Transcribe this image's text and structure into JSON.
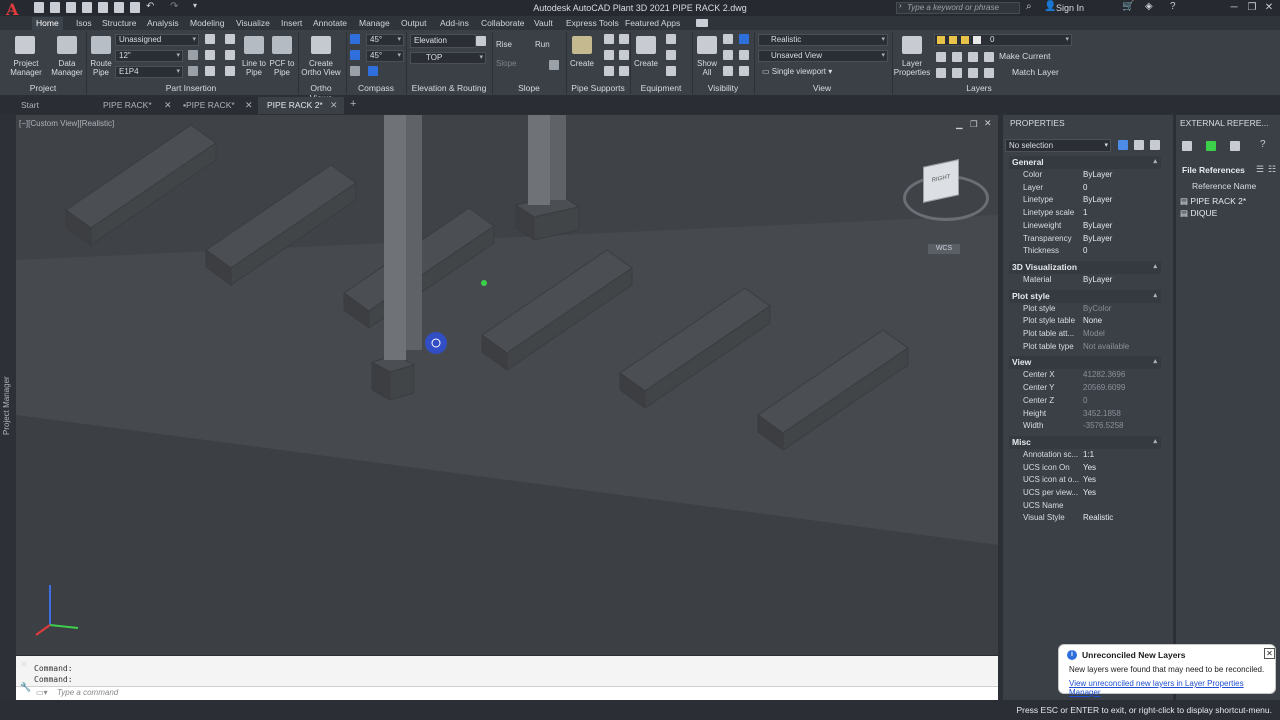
{
  "app": {
    "title": "Autodesk AutoCAD Plant 3D 2021    PIPE RACK 2.dwg",
    "search_placeholder": "Type a keyword or phrase",
    "sign_in": "Sign In"
  },
  "ribbon_tabs": [
    "Home",
    "Isos",
    "Structure",
    "Analysis",
    "Modeling",
    "Visualize",
    "Insert",
    "Annotate",
    "Manage",
    "Output",
    "Add-ins",
    "Collaborate",
    "Vault",
    "Express Tools",
    "Featured Apps"
  ],
  "ribbon": {
    "project": {
      "title": "Project",
      "project_manager": "Project\nManager",
      "data_manager": "Data\nManager"
    },
    "part_insertion": {
      "title": "Part Insertion",
      "route_pipe": "Route\nPipe",
      "line_to_pipe": "Line to\nPipe",
      "pcf_to_pipe": "PCF to\nPipe",
      "spec": "Unassigned",
      "size": "12\"",
      "line_number": "E1P4"
    },
    "ortho_views": {
      "title": "Ortho Views",
      "create": "Create\nOrtho View"
    },
    "compass": {
      "title": "Compass",
      "angle1": "45°",
      "angle2": "45°"
    },
    "elevation": {
      "title": "Elevation & Routing",
      "elevation_label": "Elevation",
      "plane": "TOP"
    },
    "slope": {
      "title": "Slope",
      "rise": "Rise",
      "run": "Run",
      "slope": "Slope"
    },
    "pipe_supports": {
      "title": "Pipe Supports",
      "create": "Create"
    },
    "equipment": {
      "title": "Equipment",
      "create": "Create"
    },
    "visibility": {
      "title": "Visibility",
      "show_all": "Show\nAll"
    },
    "view": {
      "title": "View",
      "visual_style": "Realistic",
      "named_view": "Unsaved View",
      "viewport": "Single viewport"
    },
    "layers": {
      "title": "Layers",
      "layer_properties": "Layer\nProperties",
      "current_layer": "0",
      "make_current": "Make Current",
      "match_layer": "Match Layer"
    }
  },
  "doc_tabs": {
    "start": "Start",
    "tabs": [
      "PIPE RACK*",
      "PIPE RACK*",
      "PIPE RACK 2*"
    ]
  },
  "viewport": {
    "label": "[−][Custom View][Realistic]",
    "viewcube_face": "RIGHT",
    "wcs": "WCS"
  },
  "sidebar": {
    "project_manager": "Project Manager"
  },
  "command": {
    "history": [
      "Command:",
      "Command:"
    ],
    "placeholder": "Type a command"
  },
  "properties": {
    "title": "PROPERTIES",
    "selection": "No selection",
    "sections": [
      {
        "name": "General",
        "rows": [
          [
            "Color",
            "ByLayer"
          ],
          [
            "Layer",
            "0"
          ],
          [
            "Linetype",
            "ByLayer"
          ],
          [
            "Linetype scale",
            "1"
          ],
          [
            "Lineweight",
            "ByLayer"
          ],
          [
            "Transparency",
            "ByLayer"
          ],
          [
            "Thickness",
            "0"
          ]
        ]
      },
      {
        "name": "3D Visualization",
        "rows": [
          [
            "Material",
            "ByLayer"
          ]
        ]
      },
      {
        "name": "Plot style",
        "rows": [
          [
            "Plot style",
            "ByColor"
          ],
          [
            "Plot style table",
            "None"
          ],
          [
            "Plot table att...",
            "Model"
          ],
          [
            "Plot table type",
            "Not available"
          ]
        ]
      },
      {
        "name": "View",
        "rows": [
          [
            "Center X",
            "41282.3696"
          ],
          [
            "Center Y",
            "20569.6099"
          ],
          [
            "Center Z",
            "0"
          ],
          [
            "Height",
            "3452.1858"
          ],
          [
            "Width",
            "-3576.5258"
          ]
        ]
      },
      {
        "name": "Misc",
        "rows": [
          [
            "Annotation sc...",
            "1:1"
          ],
          [
            "UCS icon On",
            "Yes"
          ],
          [
            "UCS icon at o...",
            "Yes"
          ],
          [
            "UCS per view...",
            "Yes"
          ],
          [
            "UCS Name",
            ""
          ],
          [
            "Visual Style",
            "Realistic"
          ]
        ]
      }
    ]
  },
  "xref": {
    "title": "EXTERNAL REFERE...",
    "file_references": "File References",
    "column": "Reference Name",
    "items": [
      "PIPE RACK 2*",
      "DIQUE"
    ]
  },
  "notification": {
    "title": "Unreconciled New Layers",
    "body": "New layers were found that may need to be reconciled.",
    "link": "View unreconciled new layers in Layer Properties Manager"
  },
  "status": {
    "text": "Press ESC or ENTER to exit, or right-click to display shortcut-menu."
  },
  "colors": {
    "accent": "#2f6fdc",
    "background": "#3a3d42",
    "panel": "#3b4047"
  }
}
